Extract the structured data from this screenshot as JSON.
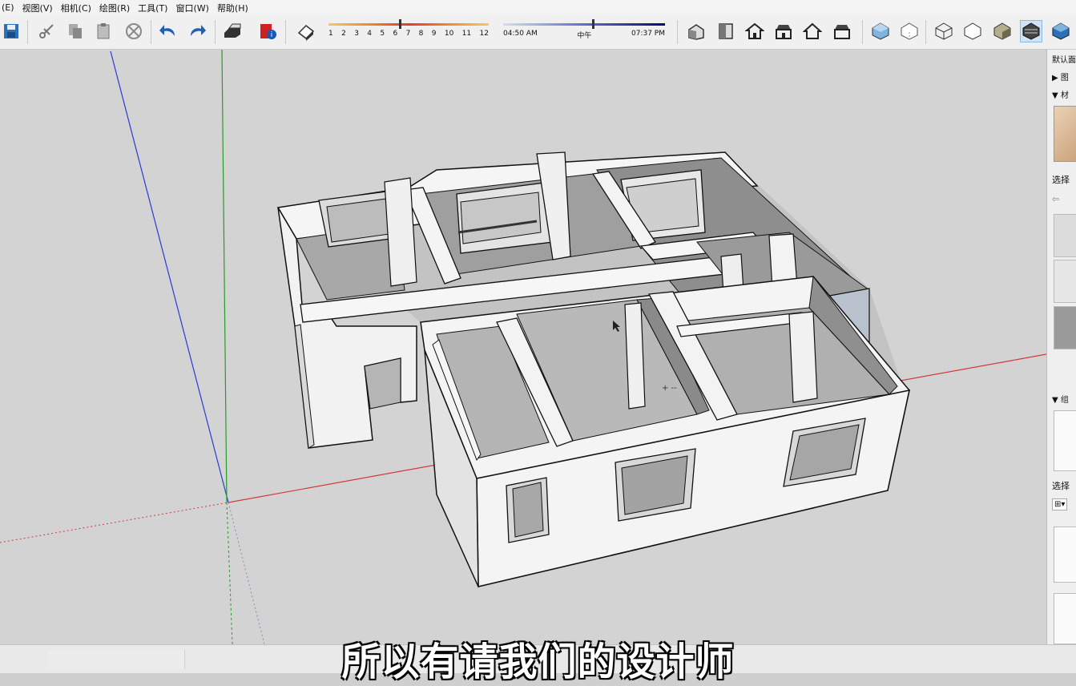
{
  "menu": {
    "items": [
      {
        "label": "(E)"
      },
      {
        "label": "视图(V)"
      },
      {
        "label": "相机(C)"
      },
      {
        "label": "绘图(R)"
      },
      {
        "label": "工具(T)"
      },
      {
        "label": "窗口(W)"
      },
      {
        "label": "帮助(H)"
      }
    ]
  },
  "toolbar": {
    "tools": [
      "save-icon",
      "cut-icon",
      "copy-icon",
      "paste-icon",
      "erase-icon",
      "undo-icon",
      "redo-icon",
      "print-icon",
      "model-info-icon",
      "shadow-toggle-icon"
    ],
    "views": [
      "iso-view-icon",
      "top-view-icon",
      "front-view-icon",
      "right-view-icon",
      "back-view-icon",
      "left-view-icon"
    ],
    "styles": [
      "xray-icon",
      "backedges-icon",
      "wireframe-icon",
      "hiddenline-icon",
      "shaded-icon",
      "shaded-textures-icon",
      "monochrome-icon"
    ],
    "active_style": "shaded-textures-icon"
  },
  "shadows": {
    "months": [
      "1",
      "2",
      "3",
      "4",
      "5",
      "6",
      "7",
      "8",
      "9",
      "10",
      "11",
      "12"
    ],
    "month_position": 0.44,
    "time_start": "04:50 AM",
    "time_noon": "中午",
    "time_end": "07:37 PM",
    "time_position": 0.55
  },
  "tray": {
    "panel_title": "默认面",
    "sections": [
      {
        "label": "▶ 图"
      },
      {
        "label": "▼ 材"
      },
      {
        "label": "选择"
      },
      {
        "label": "▼ 组"
      },
      {
        "label": "选择"
      }
    ]
  },
  "subtitle": "所以有请我们的设计师",
  "colors": {
    "axis_red": "#d23a3a",
    "axis_green": "#2a9a2a",
    "axis_blue": "#2a3ad8",
    "wall_top": "#f5f5f5",
    "wall_shade": "#9c9c9c",
    "floor": "#c4c4c4"
  }
}
